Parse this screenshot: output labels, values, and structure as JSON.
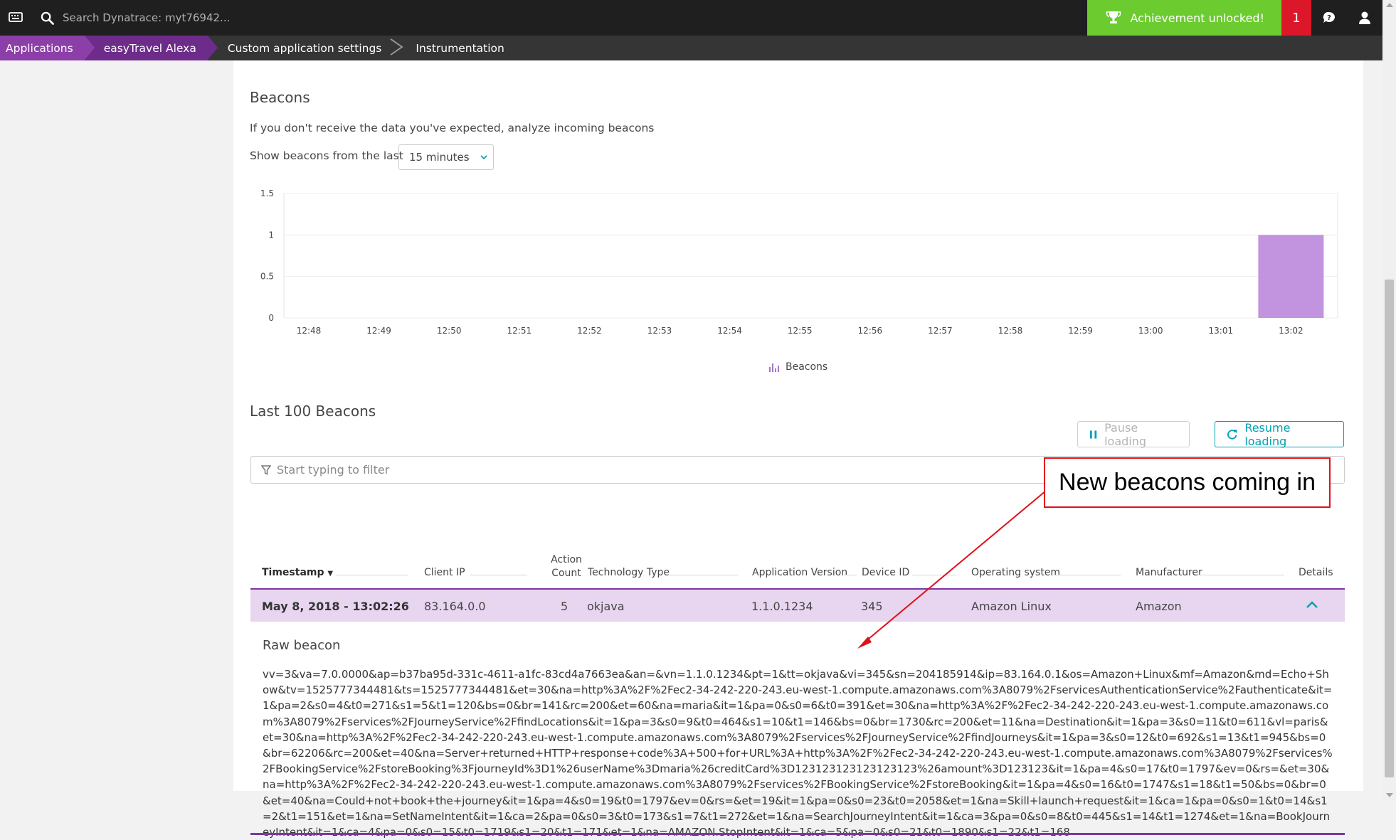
{
  "topbar": {
    "search_placeholder": "Search Dynatrace: myt76942...",
    "achievement": "Achievement unlocked!",
    "notifications": "1"
  },
  "breadcrumb": [
    "Applications",
    "easyTravel Alexa",
    "Custom application settings",
    "Instrumentation"
  ],
  "beacons": {
    "title": "Beacons",
    "description": "If you don't receive the data you've expected, analyze incoming beacons",
    "show_label": "Show beacons from the last",
    "selected_range": "15 minutes"
  },
  "chart_data": {
    "type": "bar",
    "categories": [
      "12:48",
      "12:49",
      "12:50",
      "12:51",
      "12:52",
      "12:53",
      "12:54",
      "12:55",
      "12:56",
      "12:57",
      "12:58",
      "12:59",
      "13:00",
      "13:01",
      "13:02"
    ],
    "series": [
      {
        "name": "Beacons",
        "values": [
          0,
          0,
          0,
          0,
          0,
          0,
          0,
          0,
          0,
          0,
          0,
          0,
          0,
          0,
          1
        ]
      }
    ],
    "yticks": [
      "0",
      "0.5",
      "1",
      "1.5"
    ],
    "ylim": [
      0,
      1.5
    ],
    "legend": "bottom-center",
    "bar_color": "#c293de"
  },
  "last100": {
    "title": "Last 100 Beacons",
    "pause_label": "Pause loading",
    "resume_label": "Resume loading",
    "filter_placeholder": "Start typing to filter"
  },
  "table": {
    "headers": {
      "timestamp": "Timestamp",
      "client_ip": "Client IP",
      "action_count_1": "Action",
      "action_count_2": "Count",
      "technology_type": "Technology Type",
      "app_version": "Application Version",
      "device_id": "Device ID",
      "os": "Operating system",
      "manufacturer": "Manufacturer",
      "details": "Details"
    },
    "row": {
      "timestamp": "May 8, 2018 - 13:02:26",
      "client_ip": "83.164.0.0",
      "action_count": "5",
      "technology_type": "okjava",
      "app_version": "1.1.0.1234",
      "device_id": "345",
      "os": "Amazon Linux",
      "manufacturer": "Amazon"
    }
  },
  "raw_beacon": {
    "title": "Raw beacon",
    "text": "vv=3&va=7.0.0000&ap=b37ba95d-331c-4611-a1fc-83cd4a7663ea&an=&vn=1.1.0.1234&pt=1&tt=okjava&vi=345&sn=204185914&ip=83.164.0.1&os=Amazon+Linux&mf=Amazon&md=Echo+Show&tv=1525777344481&ts=1525777344481&et=30&na=http%3A%2F%2Fec2-34-242-220-243.eu-west-1.compute.amazonaws.com%3A8079%2FservicesAuthenticationService%2Fauthenticate&it=1&pa=2&s0=4&t0=271&s1=5&t1=120&bs=0&br=141&rc=200&et=60&na=maria&it=1&pa=0&s0=6&t0=391&et=30&na=http%3A%2F%2Fec2-34-242-220-243.eu-west-1.compute.amazonaws.com%3A8079%2Fservices%2FJourneyService%2FfindLocations&it=1&pa=3&s0=9&t0=464&s1=10&t1=146&bs=0&br=1730&rc=200&et=11&na=Destination&it=1&pa=3&s0=11&t0=611&vl=paris&et=30&na=http%3A%2F%2Fec2-34-242-220-243.eu-west-1.compute.amazonaws.com%3A8079%2Fservices%2FJourneyService%2FfindJourneys&it=1&pa=3&s0=12&t0=692&s1=13&t1=945&bs=0&br=62206&rc=200&et=40&na=Server+returned+HTTP+response+code%3A+500+for+URL%3A+http%3A%2F%2Fec2-34-242-220-243.eu-west-1.compute.amazonaws.com%3A8079%2Fservices%2FBookingService%2FstoreBooking%3FjourneyId%3D1%26userName%3Dmaria%26creditCard%3D123123123123123123%26amount%3D123123&it=1&pa=4&s0=17&t0=1797&ev=0&rs=&et=30&na=http%3A%2F%2Fec2-34-242-220-243.eu-west-1.compute.amazonaws.com%3A8079%2Fservices%2FBookingService%2FstoreBooking&it=1&pa=4&s0=16&t0=1747&s1=18&t1=50&bs=0&br=0&et=40&na=Could+not+book+the+journey&it=1&pa=4&s0=19&t0=1797&ev=0&rs=&et=19&it=1&pa=0&s0=23&t0=2058&et=1&na=Skill+launch+request&it=1&ca=1&pa=0&s0=1&t0=14&s1=2&t1=151&et=1&na=SetNameIntent&it=1&ca=2&pa=0&s0=3&t0=173&s1=7&t1=272&et=1&na=SearchJourneyIntent&it=1&ca=3&pa=0&s0=8&t0=445&s1=14&t1=1274&et=1&na=BookJourneyIntent&it=1&ca=4&pa=0&s0=15&t0=1719&s1=20&t1=171&et=1&na=AMAZON.StopIntent&it=1&ca=5&pa=0&s0=21&t0=1890&s1=22&t1=168"
  },
  "annotation": "New beacons coming in",
  "colors": {
    "accent": "#00a1b2",
    "purple": "#7c38a1",
    "achievement": "#6bcb2f",
    "alert": "#dc172a",
    "annotation": "#e0101a"
  }
}
